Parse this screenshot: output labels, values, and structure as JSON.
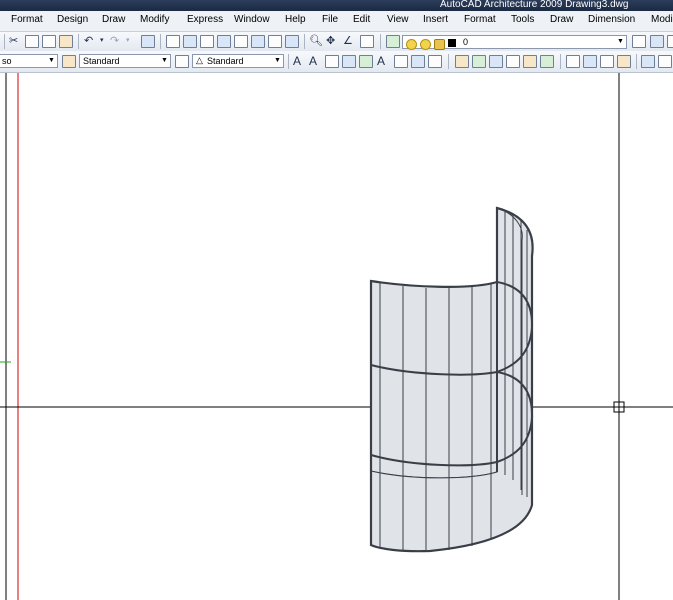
{
  "window": {
    "title": "AutoCAD Architecture 2009 Drawing3.dwg"
  },
  "menu": [
    "Format",
    "Design",
    "Draw",
    "Modify",
    "Express",
    "Window",
    "Help",
    "File",
    "Edit",
    "View",
    "Insert",
    "Format",
    "Tools",
    "Draw",
    "Dimension",
    "Modi"
  ],
  "toolbar1": {
    "layer_value": "0"
  },
  "toolbar2": {
    "visual_style_value": "so",
    "text_style_value": "Standard",
    "dim_style_value": "Standard"
  },
  "colors": {
    "titlebar": "#1c2a43",
    "menubar": "#eef1f6",
    "toolbar": "#e4e9f1",
    "ucs_red": "#d40000",
    "ucs_green": "#22aa22",
    "wall_fill": "#e0e3e8",
    "wall_stroke": "#3a3f47"
  },
  "icons": [
    "cut-icon",
    "copy-icon",
    "paste-icon",
    "match-properties-icon",
    "undo-icon",
    "redo-icon",
    "pan-icon",
    "zoom-realtime-icon",
    "zoom-window-icon",
    "layer-properties-icon",
    "lightbulb-icon",
    "sun-icon",
    "lock-icon",
    "text-icon",
    "dimension-icon",
    "orbit-icon"
  ]
}
